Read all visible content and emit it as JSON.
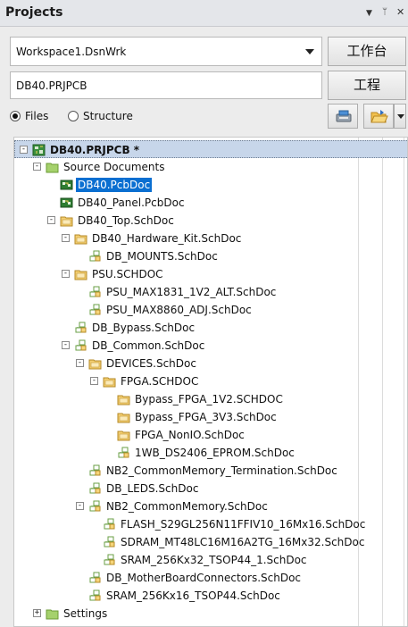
{
  "panel": {
    "title": "Projects",
    "menu_glyph": "▼",
    "pin_glyph": "ᛘ",
    "close_glyph": "✕"
  },
  "workspace": {
    "value": "Workspace1.DsnWrk",
    "button_label": "工作台"
  },
  "project": {
    "value": "DB40.PRJPCB",
    "button_label": "工程"
  },
  "view_mode": {
    "options": [
      "Files",
      "Structure"
    ],
    "selected": "Files"
  },
  "toolbar": {
    "compile_icon": "compile-icon",
    "open_icon": "open-folder-icon"
  },
  "tree": [
    {
      "label": "DB40.PRJPCB *",
      "icon": "pcb-project",
      "depth": 0,
      "toggle": "-",
      "state": "root"
    },
    {
      "label": "Source Documents",
      "icon": "folder-green",
      "depth": 1,
      "toggle": "-"
    },
    {
      "label": "DB40.PcbDoc",
      "icon": "pcb-doc",
      "depth": 2,
      "toggle": "",
      "state": "selected"
    },
    {
      "label": "DB40_Panel.PcbDoc",
      "icon": "pcb-doc",
      "depth": 2,
      "toggle": ""
    },
    {
      "label": "DB40_Top.SchDoc",
      "icon": "sch-folder",
      "depth": 2,
      "toggle": "-"
    },
    {
      "label": "DB40_Hardware_Kit.SchDoc",
      "icon": "sch-folder",
      "depth": 3,
      "toggle": "-"
    },
    {
      "label": "DB_MOUNTS.SchDoc",
      "icon": "sch-doc",
      "depth": 4,
      "toggle": ""
    },
    {
      "label": "PSU.SCHDOC",
      "icon": "sch-folder",
      "depth": 3,
      "toggle": "-"
    },
    {
      "label": "PSU_MAX1831_1V2_ALT.SchDoc",
      "icon": "sch-doc",
      "depth": 4,
      "toggle": ""
    },
    {
      "label": "PSU_MAX8860_ADJ.SchDoc",
      "icon": "sch-doc",
      "depth": 4,
      "toggle": ""
    },
    {
      "label": "DB_Bypass.SchDoc",
      "icon": "sch-doc",
      "depth": 3,
      "toggle": ""
    },
    {
      "label": "DB_Common.SchDoc",
      "icon": "sch-doc",
      "depth": 3,
      "toggle": "-"
    },
    {
      "label": "DEVICES.SchDoc",
      "icon": "sch-folder",
      "depth": 4,
      "toggle": "-"
    },
    {
      "label": "FPGA.SCHDOC",
      "icon": "sch-folder",
      "depth": 5,
      "toggle": "-"
    },
    {
      "label": "Bypass_FPGA_1V2.SCHDOC",
      "icon": "sch-folder",
      "depth": 6,
      "toggle": ""
    },
    {
      "label": "Bypass_FPGA_3V3.SchDoc",
      "icon": "sch-folder",
      "depth": 6,
      "toggle": ""
    },
    {
      "label": "FPGA_NonIO.SchDoc",
      "icon": "sch-folder",
      "depth": 6,
      "toggle": ""
    },
    {
      "label": "1WB_DS2406_EPROM.SchDoc",
      "icon": "sch-doc",
      "depth": 6,
      "toggle": ""
    },
    {
      "label": "NB2_CommonMemory_Termination.SchDoc",
      "icon": "sch-doc",
      "depth": 4,
      "toggle": ""
    },
    {
      "label": "DB_LEDS.SchDoc",
      "icon": "sch-doc",
      "depth": 4,
      "toggle": ""
    },
    {
      "label": "NB2_CommonMemory.SchDoc",
      "icon": "sch-doc",
      "depth": 4,
      "toggle": "-"
    },
    {
      "label": "FLASH_S29GL256N11FFIV10_16Mx16.SchDoc",
      "icon": "sch-doc",
      "depth": 5,
      "toggle": ""
    },
    {
      "label": "SDRAM_MT48LC16M16A2TG_16Mx32.SchDoc",
      "icon": "sch-doc",
      "depth": 5,
      "toggle": ""
    },
    {
      "label": "SRAM_256Kx32_TSOP44_1.SchDoc",
      "icon": "sch-doc",
      "depth": 5,
      "toggle": ""
    },
    {
      "label": "DB_MotherBoardConnectors.SchDoc",
      "icon": "sch-doc",
      "depth": 4,
      "toggle": ""
    },
    {
      "label": "SRAM_256Kx16_TSOP44.SchDoc",
      "icon": "sch-doc",
      "depth": 4,
      "toggle": ""
    },
    {
      "label": "Settings",
      "icon": "folder-green",
      "depth": 1,
      "toggle": "+"
    }
  ],
  "colors": {
    "selection": "#0a6fd1",
    "root_highlight": "#c7d6ea",
    "folder_green": "#9ccc65",
    "sch_folder": "#f2c96b",
    "pcb_green": "#2e7d32"
  }
}
